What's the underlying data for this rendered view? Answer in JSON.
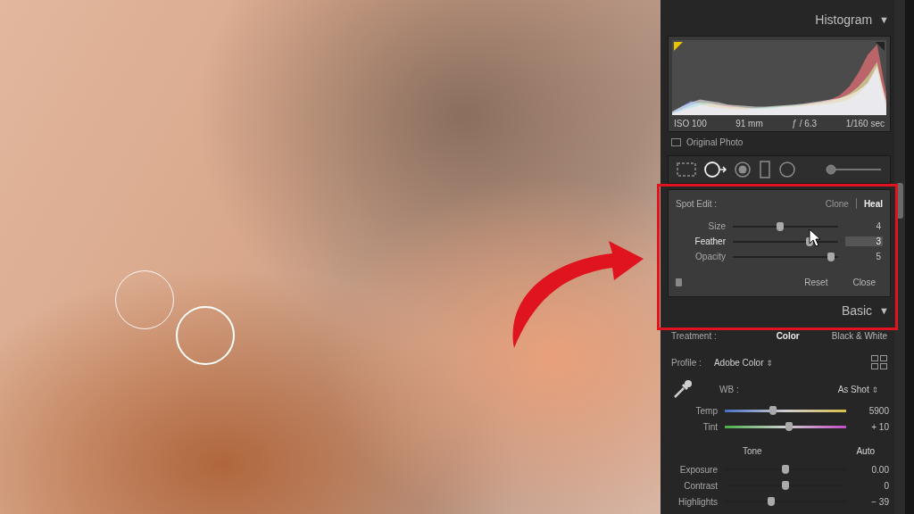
{
  "histogram": {
    "title": "Histogram",
    "toggle": "▼",
    "clip_warnings": {
      "shadows": true,
      "highlights": false
    },
    "series": [
      {
        "name": "luminance",
        "color": "#c8c8c8",
        "values": [
          5,
          12,
          18,
          22,
          20,
          18,
          15,
          14,
          13,
          12,
          12,
          13,
          14,
          15,
          16,
          18,
          20,
          22,
          24,
          28,
          35,
          45,
          70,
          20
        ]
      },
      {
        "name": "red",
        "color": "#e2343e",
        "values": [
          2,
          6,
          10,
          14,
          16,
          15,
          14,
          12,
          10,
          9,
          9,
          10,
          12,
          13,
          15,
          17,
          19,
          22,
          28,
          40,
          60,
          85,
          100,
          30
        ]
      },
      {
        "name": "green",
        "color": "#3cc85a",
        "values": [
          3,
          8,
          14,
          18,
          17,
          14,
          12,
          11,
          10,
          10,
          11,
          12,
          13,
          14,
          15,
          16,
          18,
          20,
          24,
          30,
          40,
          55,
          75,
          15
        ]
      },
      {
        "name": "blue",
        "color": "#3a6cf0",
        "values": [
          4,
          12,
          20,
          16,
          12,
          10,
          9,
          8,
          8,
          9,
          10,
          11,
          12,
          12,
          13,
          14,
          15,
          16,
          18,
          22,
          30,
          45,
          65,
          10
        ]
      }
    ],
    "info": [
      "ISO 100",
      "91 mm",
      "ƒ / 6.3",
      "1/160 sec"
    ],
    "original_photo": {
      "label": "Original Photo",
      "checked": false
    }
  },
  "tools": [
    {
      "kind": "crop",
      "selected": false
    },
    {
      "kind": "spot",
      "selected": true
    },
    {
      "kind": "redeye",
      "selected": false
    },
    {
      "kind": "gradient",
      "selected": false
    },
    {
      "kind": "radial",
      "selected": false
    },
    {
      "kind": "brush",
      "selected": false
    }
  ],
  "spot_edit": {
    "label": "Spot Edit :",
    "modes": [
      {
        "label": "Clone",
        "selected": false
      },
      {
        "label": "Heal",
        "selected": true
      }
    ],
    "sliders": [
      {
        "label": "Size",
        "value": "4",
        "level": 0.45,
        "active": false
      },
      {
        "label": "Feather",
        "value": "3",
        "level": 0.73,
        "active": true
      },
      {
        "label": "Opacity",
        "value": "5",
        "level": 0.93,
        "active": false
      }
    ],
    "buttons": [
      "Reset",
      "Close"
    ]
  },
  "basic": {
    "title": "Basic",
    "toggle": "▼",
    "treatment": {
      "label": "Treatment :",
      "options": [
        {
          "label": "Color",
          "selected": true
        },
        {
          "label": "Black & White",
          "selected": false
        }
      ]
    },
    "profile": {
      "label": "Profile :",
      "value": "Adobe Color",
      "caret": "⇕"
    },
    "wb": {
      "label": "WB :",
      "value": "As Shot",
      "caret": "⇕",
      "sliders": [
        {
          "kind": "temp",
          "label": "Temp",
          "value": "5900",
          "level": 0.4
        },
        {
          "kind": "tint",
          "label": "Tint",
          "value": "+ 10",
          "level": 0.53
        }
      ]
    },
    "tone": {
      "label": "Tone",
      "auto": "Auto",
      "sliders": [
        {
          "kind": "plain",
          "label": "Exposure",
          "value": "0.00",
          "level": 0.5
        },
        {
          "kind": "plain",
          "label": "Contrast",
          "value": "0",
          "level": 0.5
        },
        {
          "kind": "plain",
          "label": "Highlights",
          "value": "− 39",
          "level": 0.38
        }
      ]
    }
  },
  "photo": {
    "markers": [
      {
        "selected": false
      },
      {
        "selected": true
      }
    ]
  }
}
